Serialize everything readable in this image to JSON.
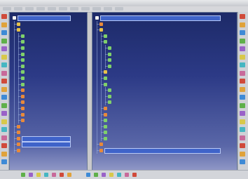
{
  "window": {
    "title": "",
    "menus": [
      "",
      "",
      "",
      "",
      "",
      "",
      "",
      "",
      "",
      "",
      ""
    ]
  },
  "colors": {
    "bg_top": "#1d2a68",
    "bg_bottom": "#8f97c6",
    "selection": "#3f63c9",
    "text": "#eaf0ff"
  },
  "left_toolbar_icons": [
    "select-icon",
    "hand-icon",
    "zoom-icon",
    "rotate-icon",
    "pan-icon",
    "view-icon",
    "measure-icon",
    "section-icon",
    "ruler-icon",
    "snap-icon",
    "light-icon",
    "color-icon",
    "grid-icon",
    "axis-icon",
    "cube-icon",
    "sphere-icon",
    "render-icon",
    "camera-icon",
    "help-icon"
  ],
  "right_toolbar_icons": [
    "part-icon",
    "body-icon",
    "sketch-icon",
    "pad-icon",
    "pocket-icon",
    "hole-icon",
    "fillet-icon",
    "chamfer-icon",
    "draft-icon",
    "shell-icon",
    "mirror-icon",
    "pattern-icon",
    "gear-icon",
    "wrench-icon",
    "assembly-icon",
    "constraint-icon",
    "update-icon",
    "apply-icon",
    "close-icon"
  ],
  "status_icons": [
    "home-icon",
    "back-icon",
    "forward-icon",
    "fit-icon",
    "zoom-in-icon",
    "zoom-out-icon",
    "rotate-icon",
    "normal-view-icon",
    "iso-view-icon",
    "front-view-icon",
    "shading-icon",
    "hide-icon",
    "swap-icon",
    "layer-icon"
  ],
  "left_tree": [
    {
      "level": 0,
      "icon": "root",
      "label": "",
      "selected": true
    },
    {
      "level": 1,
      "icon": "node",
      "label": ""
    },
    {
      "level": 1,
      "icon": "node",
      "label": ""
    },
    {
      "level": 2,
      "icon": "leaf",
      "label": ""
    },
    {
      "level": 2,
      "icon": "leaf",
      "label": ""
    },
    {
      "level": 2,
      "icon": "leaf",
      "label": ""
    },
    {
      "level": 2,
      "icon": "leaf",
      "label": ""
    },
    {
      "level": 2,
      "icon": "leaf",
      "label": ""
    },
    {
      "level": 2,
      "icon": "leaf",
      "label": ""
    },
    {
      "level": 2,
      "icon": "leaf",
      "label": ""
    },
    {
      "level": 2,
      "icon": "leaf",
      "label": ""
    },
    {
      "level": 2,
      "icon": "leaf",
      "label": ""
    },
    {
      "level": 2,
      "icon": "part",
      "label": ""
    },
    {
      "level": 2,
      "icon": "part",
      "label": ""
    },
    {
      "level": 2,
      "icon": "part",
      "label": ""
    },
    {
      "level": 2,
      "icon": "part",
      "label": ""
    },
    {
      "level": 2,
      "icon": "part",
      "label": ""
    },
    {
      "level": 2,
      "icon": "part",
      "label": ""
    },
    {
      "level": 1,
      "icon": "part",
      "label": ""
    },
    {
      "level": 1,
      "icon": "part",
      "label": ""
    },
    {
      "level": 1,
      "icon": "part",
      "label": "",
      "selected": true
    },
    {
      "level": 1,
      "icon": "part",
      "label": "",
      "selected": true
    },
    {
      "level": 1,
      "icon": "part",
      "label": ""
    }
  ],
  "right_tree": [
    {
      "level": 0,
      "icon": "root",
      "label": "",
      "selected": true
    },
    {
      "level": 1,
      "icon": "part",
      "label": ""
    },
    {
      "level": 1,
      "icon": "node",
      "label": ""
    },
    {
      "level": 2,
      "icon": "leaf",
      "label": ""
    },
    {
      "level": 2,
      "icon": "leaf",
      "label": ""
    },
    {
      "level": 3,
      "icon": "leaf",
      "label": ""
    },
    {
      "level": 3,
      "icon": "leaf",
      "label": ""
    },
    {
      "level": 3,
      "icon": "leaf",
      "label": ""
    },
    {
      "level": 3,
      "icon": "leaf",
      "label": ""
    },
    {
      "level": 2,
      "icon": "node",
      "label": ""
    },
    {
      "level": 2,
      "icon": "leaf",
      "label": ""
    },
    {
      "level": 2,
      "icon": "leaf",
      "label": ""
    },
    {
      "level": 3,
      "icon": "leaf",
      "label": ""
    },
    {
      "level": 3,
      "icon": "leaf",
      "label": ""
    },
    {
      "level": 3,
      "icon": "leaf",
      "label": ""
    },
    {
      "level": 2,
      "icon": "part",
      "label": ""
    },
    {
      "level": 2,
      "icon": "part",
      "label": ""
    },
    {
      "level": 2,
      "icon": "leaf",
      "label": ""
    },
    {
      "level": 2,
      "icon": "leaf",
      "label": ""
    },
    {
      "level": 2,
      "icon": "leaf",
      "label": ""
    },
    {
      "level": 2,
      "icon": "leaf",
      "label": ""
    },
    {
      "level": 1,
      "icon": "part",
      "label": ""
    },
    {
      "level": 1,
      "icon": "part",
      "label": "",
      "selected": true
    }
  ]
}
